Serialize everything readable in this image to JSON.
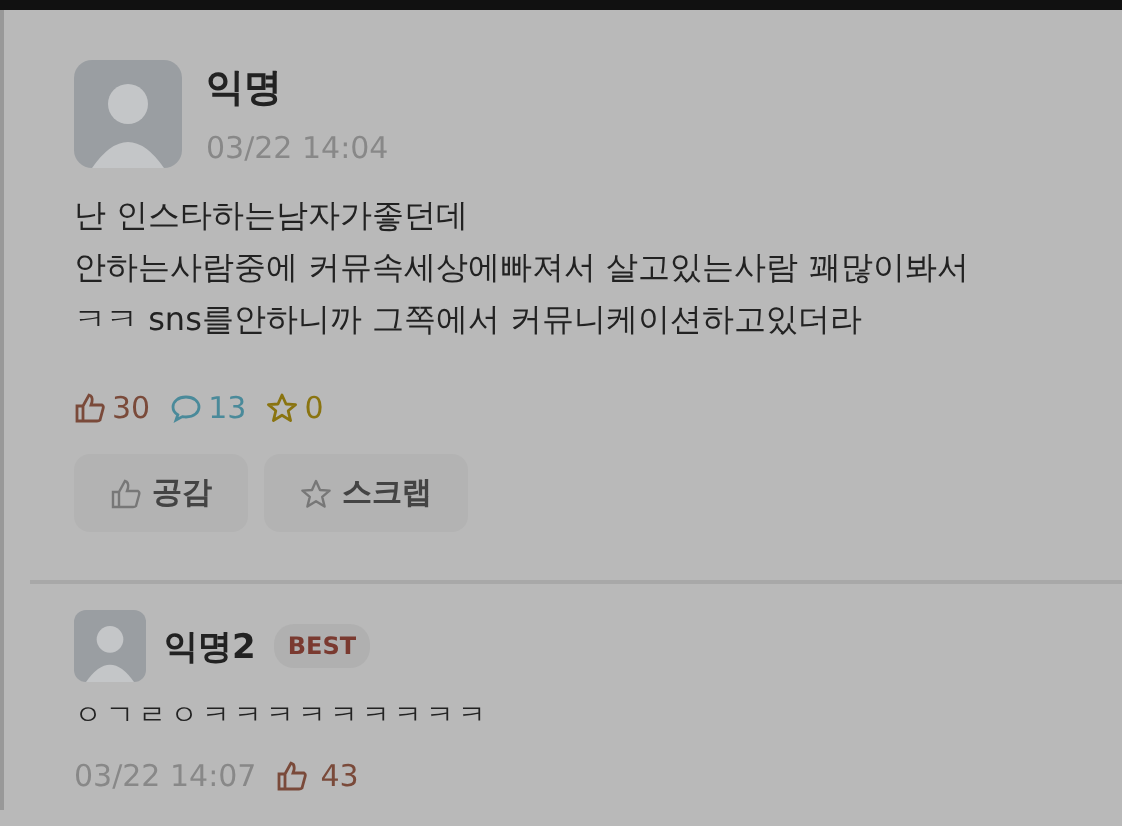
{
  "post": {
    "author": "익명",
    "time": "03/22 14:04",
    "lines": [
      "난 인스타하는남자가좋던데",
      "안하는사람중에 커뮤속세상에빠져서 살고있는사람 꽤많이봐서",
      "ㅋㅋ sns를안하니까 그쪽에서 커뮤니케이션하고있더라"
    ],
    "stats": [
      {
        "kind": "like",
        "count": "30",
        "color": "#7a4a3a"
      },
      {
        "kind": "comment",
        "count": "13",
        "color": "#4a8a9a"
      },
      {
        "kind": "scrap",
        "count": "0",
        "color": "#8a7410"
      }
    ],
    "buttons": [
      {
        "kind": "like",
        "label": "공감"
      },
      {
        "kind": "scrap",
        "label": "스크랩"
      }
    ]
  },
  "comments": [
    {
      "author": "익명2",
      "badge": "BEST",
      "text": "ㅇㄱㄹㅇㅋㅋㅋㅋㅋㅋㅋㅋㅋ",
      "time": "03/22 14:07",
      "likes": "43"
    }
  ]
}
